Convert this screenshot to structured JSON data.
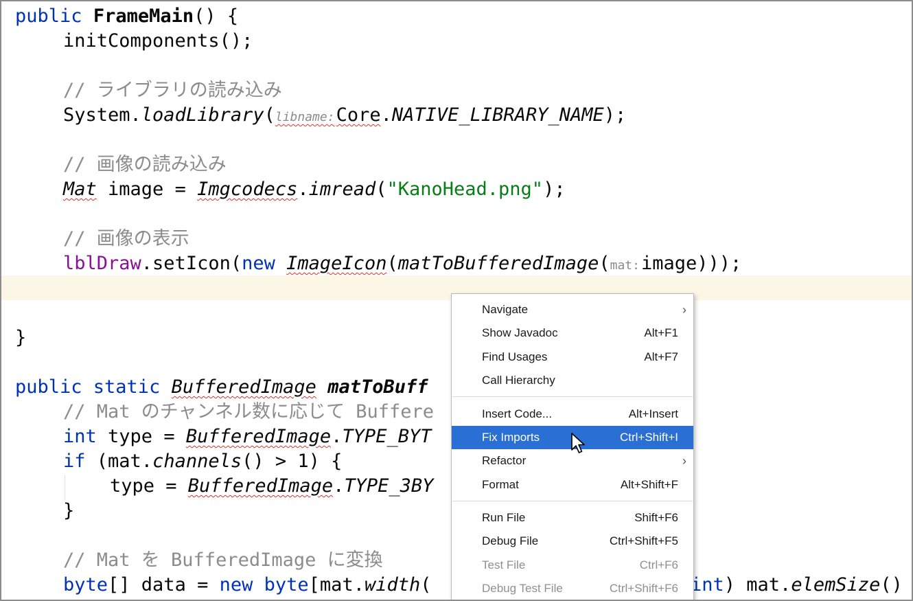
{
  "code": {
    "line1": {
      "kw": "public",
      "name": "FrameMain",
      "rest": "() {"
    },
    "line2": {
      "text": "initComponents();"
    },
    "comment_lib": "// ライブラリの読み込み",
    "line_lib": {
      "obj": "System.",
      "method": "loadLibrary",
      "open": "(",
      "hint": "libname:",
      "cls": "Core",
      "dot": ".",
      "const": "NATIVE_LIBRARY_NAME",
      "close": ");"
    },
    "comment_read": "// 画像の読み込み",
    "line_read": {
      "type": "Mat",
      "mid": " image = ",
      "cls": "Imgcodecs",
      "dot": ".",
      "method": "imread",
      "open": "(",
      "str": "\"KanoHead.png\"",
      "close": ");"
    },
    "comment_show": "// 画像の表示",
    "line_show": {
      "field": "lblDraw",
      "call": ".setIcon(",
      "kw": "new",
      "space": " ",
      "cls": "ImageIcon",
      "open": "(",
      "method": "matToBufferedImage",
      "open2": "(",
      "hint": "mat:",
      "arg": "image",
      "close": ")));"
    },
    "brace": "}",
    "line_sig": {
      "kw": "public static",
      "space": " ",
      "type": "BufferedImage",
      "space2": " ",
      "name": "matToBuff"
    },
    "comment_mat": "// Mat のチャンネル数に応じて Buffere",
    "line_int": {
      "kw": "int",
      "mid": " type = ",
      "cls": "BufferedImage",
      "dot": ".",
      "const": "TYPE_BYT"
    },
    "line_if": {
      "kw": "if",
      "mid1": " (mat.",
      "method": "channels",
      "mid2": "() > 1) {"
    },
    "line_type3": {
      "mid": "type = ",
      "cls": "BufferedImage",
      "dot": ".",
      "const": "TYPE_3BY"
    },
    "brace2": "}",
    "comment_conv": "// Mat を BufferedImage に変換",
    "line_byte": {
      "kw1": "byte",
      "mid1": "[] data = ",
      "kw2": "new",
      "space": " ",
      "kw3": "byte",
      "mid2": "[mat.",
      "method": "width",
      "paren": "(",
      "kw4": "int",
      "mid3": ") mat.",
      "method2": "elemSize",
      "end": "()"
    }
  },
  "context_menu": {
    "items": [
      {
        "label": "Navigate",
        "shortcut": "",
        "submenu": true
      },
      {
        "label": "Show Javadoc",
        "shortcut": "Alt+F1"
      },
      {
        "label": "Find Usages",
        "shortcut": "Alt+F7"
      },
      {
        "label": "Call Hierarchy",
        "shortcut": ""
      },
      {
        "label": "Insert Code...",
        "shortcut": "Alt+Insert"
      },
      {
        "label": "Fix Imports",
        "shortcut": "Ctrl+Shift+I",
        "selected": true
      },
      {
        "label": "Refactor",
        "shortcut": "",
        "submenu": true
      },
      {
        "label": "Format",
        "shortcut": "Alt+Shift+F"
      },
      {
        "label": "Run File",
        "shortcut": "Shift+F6"
      },
      {
        "label": "Debug File",
        "shortcut": "Ctrl+Shift+F5"
      },
      {
        "label": "Test File",
        "shortcut": "Ctrl+F6",
        "disabled": true
      },
      {
        "label": "Debug Test File",
        "shortcut": "Ctrl+Shift+F6",
        "disabled": true
      }
    ],
    "submenu_arrow": "›"
  },
  "colors": {
    "keyword": "#0033b3",
    "string": "#067d17",
    "comment": "#8c8c8c",
    "field": "#871094",
    "caret_row": "#fcf6e6",
    "menu_selection": "#2a6fd3",
    "error_underline": "#e0302a"
  },
  "icons": {
    "cursor": "mouse-pointer-icon",
    "arrow": "chevron-right-icon"
  }
}
